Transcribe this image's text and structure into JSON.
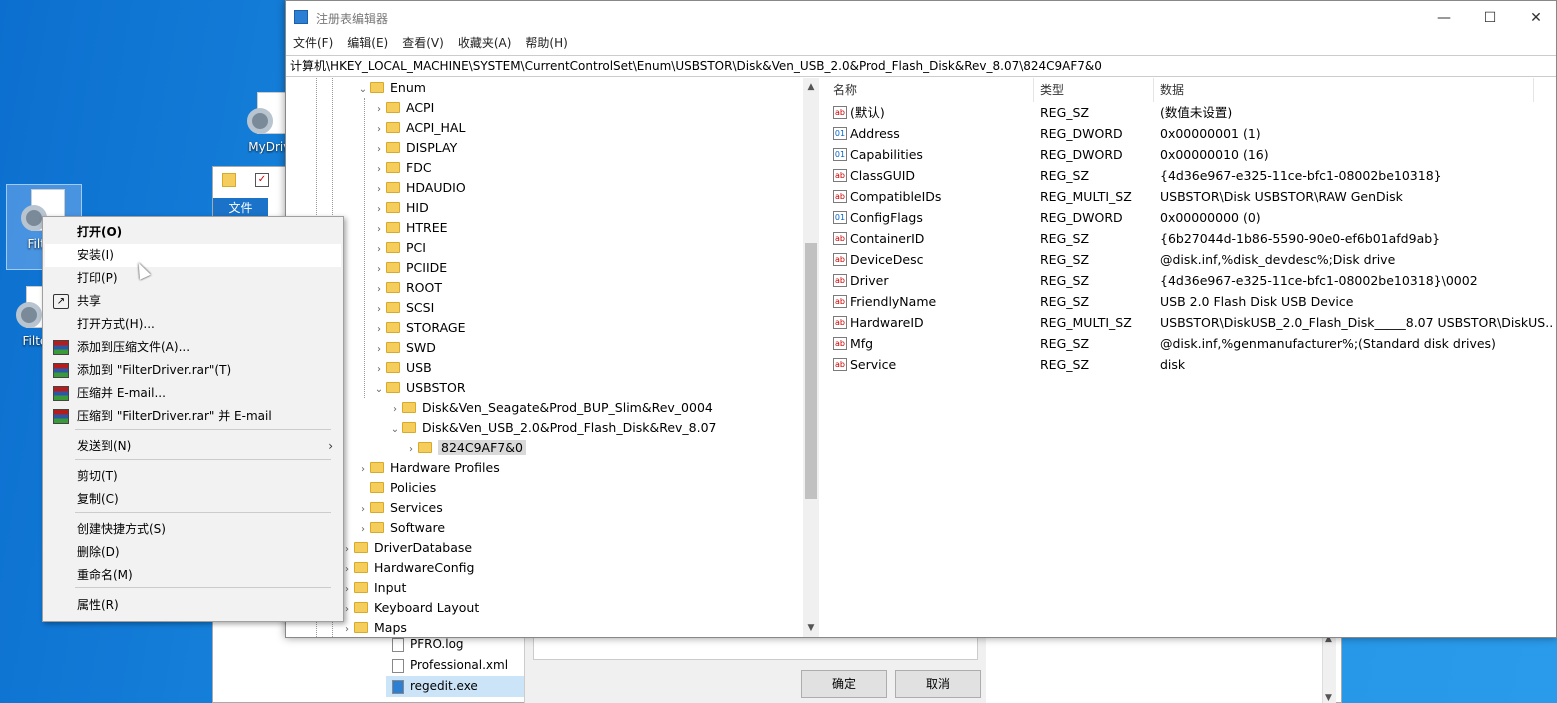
{
  "desktop": {
    "icons": [
      {
        "label": "MyDrive"
      },
      {
        "label": "FilterD"
      },
      {
        "label": "FilterD"
      }
    ]
  },
  "explorer": {
    "tab_label": "文件",
    "files": [
      "PFRO.log",
      "Professional.xml",
      "regedit.exe"
    ],
    "ok_button": "确定",
    "cancel_button": "取消"
  },
  "regedit": {
    "title": "注册表编辑器",
    "menu": [
      "文件(F)",
      "编辑(E)",
      "查看(V)",
      "收藏夹(A)",
      "帮助(H)"
    ],
    "address": "计算机\\HKEY_LOCAL_MACHINE\\SYSTEM\\CurrentControlSet\\Enum\\USBSTOR\\Disk&Ven_USB_2.0&Prod_Flash_Disk&Rev_8.07\\824C9AF7&0",
    "tree": [
      {
        "name": "Enum",
        "exp": "v"
      },
      {
        "name": "ACPI",
        "exp": ">"
      },
      {
        "name": "ACPI_HAL",
        "exp": ">"
      },
      {
        "name": "DISPLAY",
        "exp": ">"
      },
      {
        "name": "FDC",
        "exp": ">"
      },
      {
        "name": "HDAUDIO",
        "exp": ">"
      },
      {
        "name": "HID",
        "exp": ">"
      },
      {
        "name": "HTREE",
        "exp": ">"
      },
      {
        "name": "PCI",
        "exp": ">"
      },
      {
        "name": "PCIIDE",
        "exp": ">"
      },
      {
        "name": "ROOT",
        "exp": ">"
      },
      {
        "name": "SCSI",
        "exp": ">"
      },
      {
        "name": "STORAGE",
        "exp": ">"
      },
      {
        "name": "SWD",
        "exp": ">"
      },
      {
        "name": "USB",
        "exp": ">"
      },
      {
        "name": "USBSTOR",
        "exp": "v"
      },
      {
        "name": "Disk&Ven_Seagate&Prod_BUP_Slim&Rev_0004",
        "exp": ">"
      },
      {
        "name": "Disk&Ven_USB_2.0&Prod_Flash_Disk&Rev_8.07",
        "exp": "v"
      },
      {
        "name": "824C9AF7&0",
        "exp": ">"
      },
      {
        "name": "Hardware Profiles",
        "exp": ">"
      },
      {
        "name": "Policies",
        "exp": ""
      },
      {
        "name": "Services",
        "exp": ">"
      },
      {
        "name": "Software",
        "exp": ">"
      },
      {
        "name": "DriverDatabase",
        "exp": ">"
      },
      {
        "name": "HardwareConfig",
        "exp": ">"
      },
      {
        "name": "Input",
        "exp": ">"
      },
      {
        "name": "Keyboard Layout",
        "exp": ">"
      },
      {
        "name": "Maps",
        "exp": ">"
      }
    ],
    "columns": {
      "name": "名称",
      "type": "类型",
      "data": "数据"
    },
    "values": [
      {
        "name": "(默认)",
        "type": "REG_SZ",
        "data": "(数值未设置)",
        "icon": "ab"
      },
      {
        "name": "Address",
        "type": "REG_DWORD",
        "data": "0x00000001 (1)",
        "icon": "bin"
      },
      {
        "name": "Capabilities",
        "type": "REG_DWORD",
        "data": "0x00000010 (16)",
        "icon": "bin"
      },
      {
        "name": "ClassGUID",
        "type": "REG_SZ",
        "data": "{4d36e967-e325-11ce-bfc1-08002be10318}",
        "icon": "ab"
      },
      {
        "name": "CompatibleIDs",
        "type": "REG_MULTI_SZ",
        "data": "USBSTOR\\Disk USBSTOR\\RAW GenDisk",
        "icon": "ab"
      },
      {
        "name": "ConfigFlags",
        "type": "REG_DWORD",
        "data": "0x00000000 (0)",
        "icon": "bin"
      },
      {
        "name": "ContainerID",
        "type": "REG_SZ",
        "data": "{6b27044d-1b86-5590-90e0-ef6b01afd9ab}",
        "icon": "ab"
      },
      {
        "name": "DeviceDesc",
        "type": "REG_SZ",
        "data": "@disk.inf,%disk_devdesc%;Disk drive",
        "icon": "ab"
      },
      {
        "name": "Driver",
        "type": "REG_SZ",
        "data": "{4d36e967-e325-11ce-bfc1-08002be10318}\\0002",
        "icon": "ab"
      },
      {
        "name": "FriendlyName",
        "type": "REG_SZ",
        "data": "USB 2.0 Flash Disk USB Device",
        "icon": "ab"
      },
      {
        "name": "HardwareID",
        "type": "REG_MULTI_SZ",
        "data": "USBSTOR\\DiskUSB_2.0_Flash_Disk_____8.07 USBSTOR\\DiskUS...",
        "icon": "ab"
      },
      {
        "name": "Mfg",
        "type": "REG_SZ",
        "data": "@disk.inf,%genmanufacturer%;(Standard disk drives)",
        "icon": "ab"
      },
      {
        "name": "Service",
        "type": "REG_SZ",
        "data": "disk",
        "icon": "ab"
      }
    ]
  },
  "context_menu": {
    "items": [
      {
        "label": "打开(O)"
      },
      {
        "label": "安装(I)"
      },
      {
        "label": "打印(P)"
      },
      {
        "label": "共享"
      },
      {
        "label": "打开方式(H)..."
      },
      {
        "label": "添加到压缩文件(A)..."
      },
      {
        "label": "添加到 \"FilterDriver.rar\"(T)"
      },
      {
        "label": "压缩并 E-mail..."
      },
      {
        "label": "压缩到 \"FilterDriver.rar\" 并 E-mail"
      },
      {
        "label": "发送到(N)"
      },
      {
        "label": "剪切(T)"
      },
      {
        "label": "复制(C)"
      },
      {
        "label": "创建快捷方式(S)"
      },
      {
        "label": "删除(D)"
      },
      {
        "label": "重命名(M)"
      },
      {
        "label": "属性(R)"
      }
    ]
  }
}
